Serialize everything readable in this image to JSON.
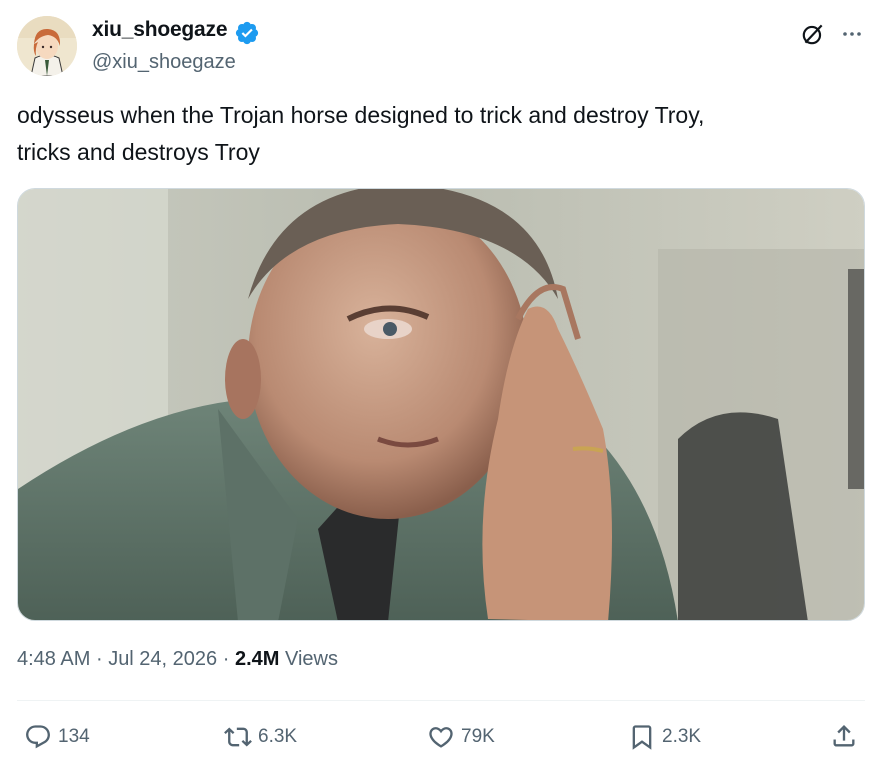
{
  "author": {
    "display_name": "xiu_shoegaze",
    "handle": "@xiu_shoegaze",
    "verified": true
  },
  "tweet": {
    "text": "odysseus when the Trojan horse designed to trick and destroy Troy,\ntricks and destroys Troy"
  },
  "media": {
    "icon": "photo-still-man-rubbing-eye"
  },
  "meta": {
    "time": "4:48 AM",
    "separator": "·",
    "date": "Jul 24, 2026",
    "views_count": "2.4M",
    "views_label": "Views"
  },
  "actions": {
    "replies": "134",
    "reposts": "6.3K",
    "likes": "79K",
    "bookmarks": "2.3K"
  },
  "colors": {
    "verified": "#1d9bf0",
    "secondary_text": "#536471",
    "primary_text": "#0f1419"
  }
}
